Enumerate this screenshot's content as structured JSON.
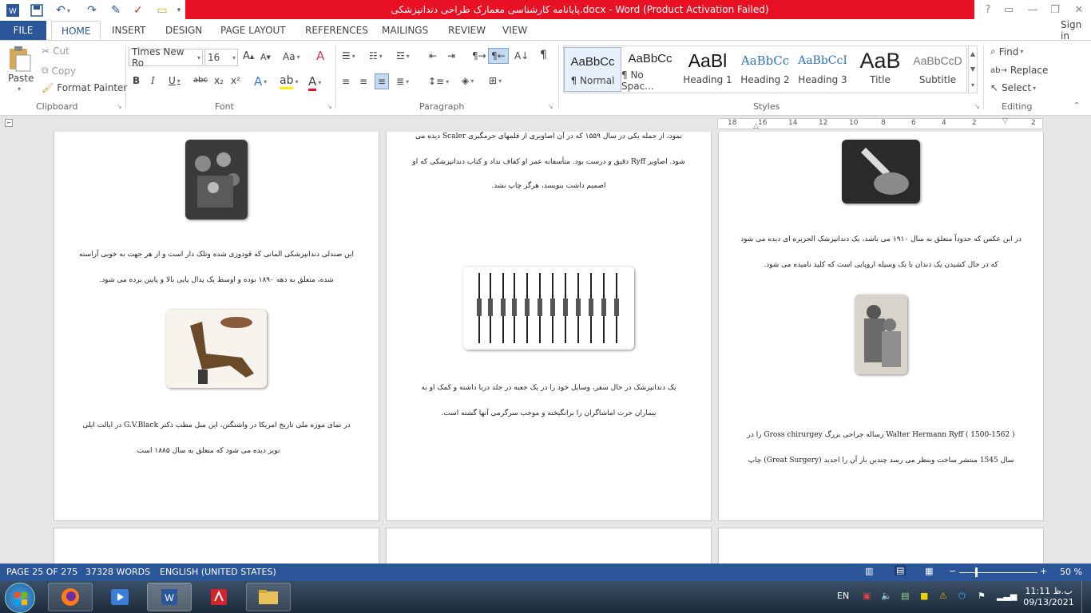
{
  "window": {
    "title": "پایانامه کارشناسی معمارک طراحی دندانپزشکی.docx -  Word (Product Activation Failed)",
    "help": "?",
    "sign_in": "Sign in"
  },
  "tabs": [
    "FILE",
    "HOME",
    "INSERT",
    "DESIGN",
    "PAGE LAYOUT",
    "REFERENCES",
    "MAILINGS",
    "REVIEW",
    "VIEW"
  ],
  "clipboard": {
    "paste": "Paste",
    "cut": "Cut",
    "copy": "Copy",
    "format_painter": "Format Painter",
    "label": "Clipboard"
  },
  "font": {
    "name": "Times New Ro",
    "size": "16",
    "label": "Font",
    "change_case": "Aa",
    "bold": "B",
    "italic": "I",
    "underline": "U",
    "strike": "abc",
    "sub": "x₂",
    "sup": "x²",
    "grow": "A",
    "shrink": "A"
  },
  "paragraph": {
    "label": "Paragraph"
  },
  "styles": {
    "label": "Styles",
    "items": [
      {
        "preview": "AaBbCc",
        "name": "¶ Normal"
      },
      {
        "preview": "AaBbCc",
        "name": "¶ No Spac..."
      },
      {
        "preview": "AaBl",
        "name": "Heading 1"
      },
      {
        "preview": "AaBbCc",
        "name": "Heading 2"
      },
      {
        "preview": "AaBbCcI",
        "name": "Heading 3"
      },
      {
        "preview": "AaB",
        "name": "Title"
      },
      {
        "preview": "AaBbCcD",
        "name": "Subtitle"
      }
    ]
  },
  "editing": {
    "find": "Find",
    "replace": "Replace",
    "select": "Select",
    "label": "Editing"
  },
  "ruler": {
    "ticks": [
      "18",
      "16",
      "14",
      "12",
      "10",
      "8",
      "6",
      "4",
      "2",
      "2"
    ]
  },
  "pages": {
    "left": {
      "para1_line1": "این صندلی دندانپزشکی المانی که قودوزی شده وتلک دار است و از هر جهت به خوبی آراسته",
      "para1_line2": "شده، متعلق به دهه ۱۸۹۰ بوده و اوسط یک پدال پایی بالا و پایین برده می شود.",
      "para2_line1": "در تمای موزه ملی تاریخ امریکا در واشنگتن، این مبل مطب دکتر G.V.Black در ایالت ایلی",
      "para2_line2": "نویز دیده می شود که متعلق به سال ۱۸۸۵ است"
    },
    "middle": {
      "para1_line1": "نمود، از جمله یکی در سال ۱۵۵۹ که در آن اصاویری از قلمهای جرمگیری Scaler دیده می",
      "para1_line2": "شود. اصاویر Ryff دقیق و درست بود. متأسفانه عمر او کفاف نداد و کتاب دندانپزشکی که او",
      "para1_line3": "اصمیم داشت بنویسد، هرگز چاپ نشد.",
      "para2_line1": "یک دندانپزشک در حال سفر، وسایل خود را در یک جعبه در جلد دربا داشته و کمک او به",
      "para2_line2": "بیماران جرت اماشاگران را برانگیخته و موجب سرگرمی آنها گشته است."
    },
    "right": {
      "para1_line1": "در این عکس که حدوداً متعلق به سال ۱۹۱۰ می باشد، یک دندانپزشک الجزیره ای دیده می شود",
      "para1_line2": "که در حال کشیدن یک دندان با یک وسیله اروپایی است که کلید نامیده می شود.",
      "para2_line1": "( 1500-1562 ) Walter Hermann Ryff رساله جراحی بزرگ Gross chirurgey را در",
      "para2_line2": "سال 1545 منتشر ساخت وبنظر می رسد چندین بار آن را اجدید (Great Surgery) چاپ"
    }
  },
  "status": {
    "page": "PAGE 25 OF 275",
    "words": "37328 WORDS",
    "language": "ENGLISH (UNITED STATES)",
    "zoom": "50 %"
  },
  "taskbar": {
    "lang": "EN",
    "time": "11:11 ب.ظ",
    "date": "09/13/2021"
  }
}
